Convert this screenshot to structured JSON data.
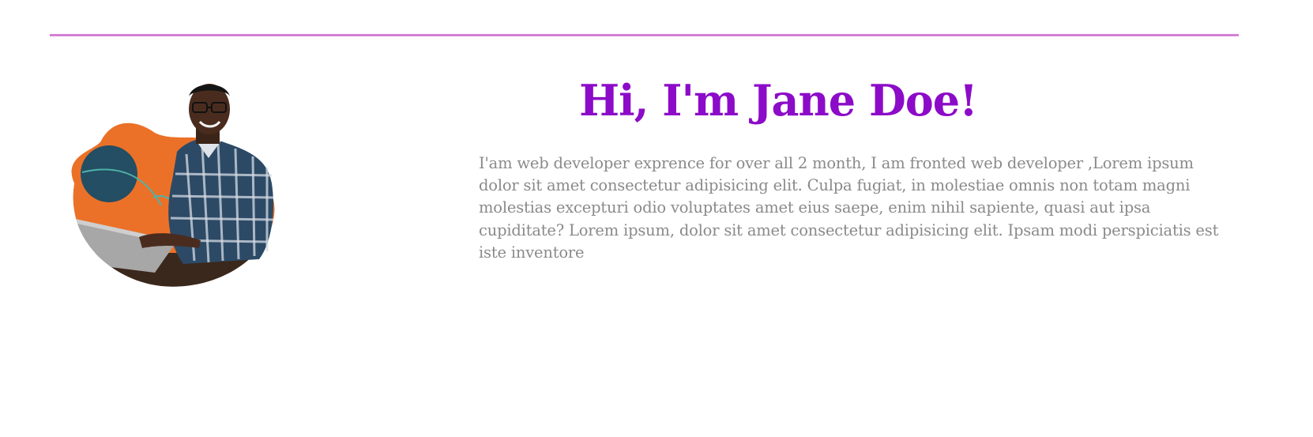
{
  "divider": {
    "color": "#d57fd5"
  },
  "hero": {
    "title": "Hi, I'm Jane Doe!",
    "bio": "I'am web developer exprence for over all 2 month, I am fronted web developer ,Lorem ipsum dolor sit amet consectetur adipisicing elit. Culpa fugiat, in molestiae omnis non totam magni molestias excepturi odio voluptates amet eius saepe, enim nihil sapiente, quasi aut ipsa cupiditate? Lorem ipsum, dolor sit amet consectetur adipisicing elit. Ipsam modi perspiciatis est iste inventore",
    "title_color": "#8c0bc8",
    "bio_color": "#8a8a8a"
  },
  "profile_image": {
    "subject": "person-with-laptop",
    "blob_color": "#ec7128",
    "circle_color": "#234e63"
  }
}
